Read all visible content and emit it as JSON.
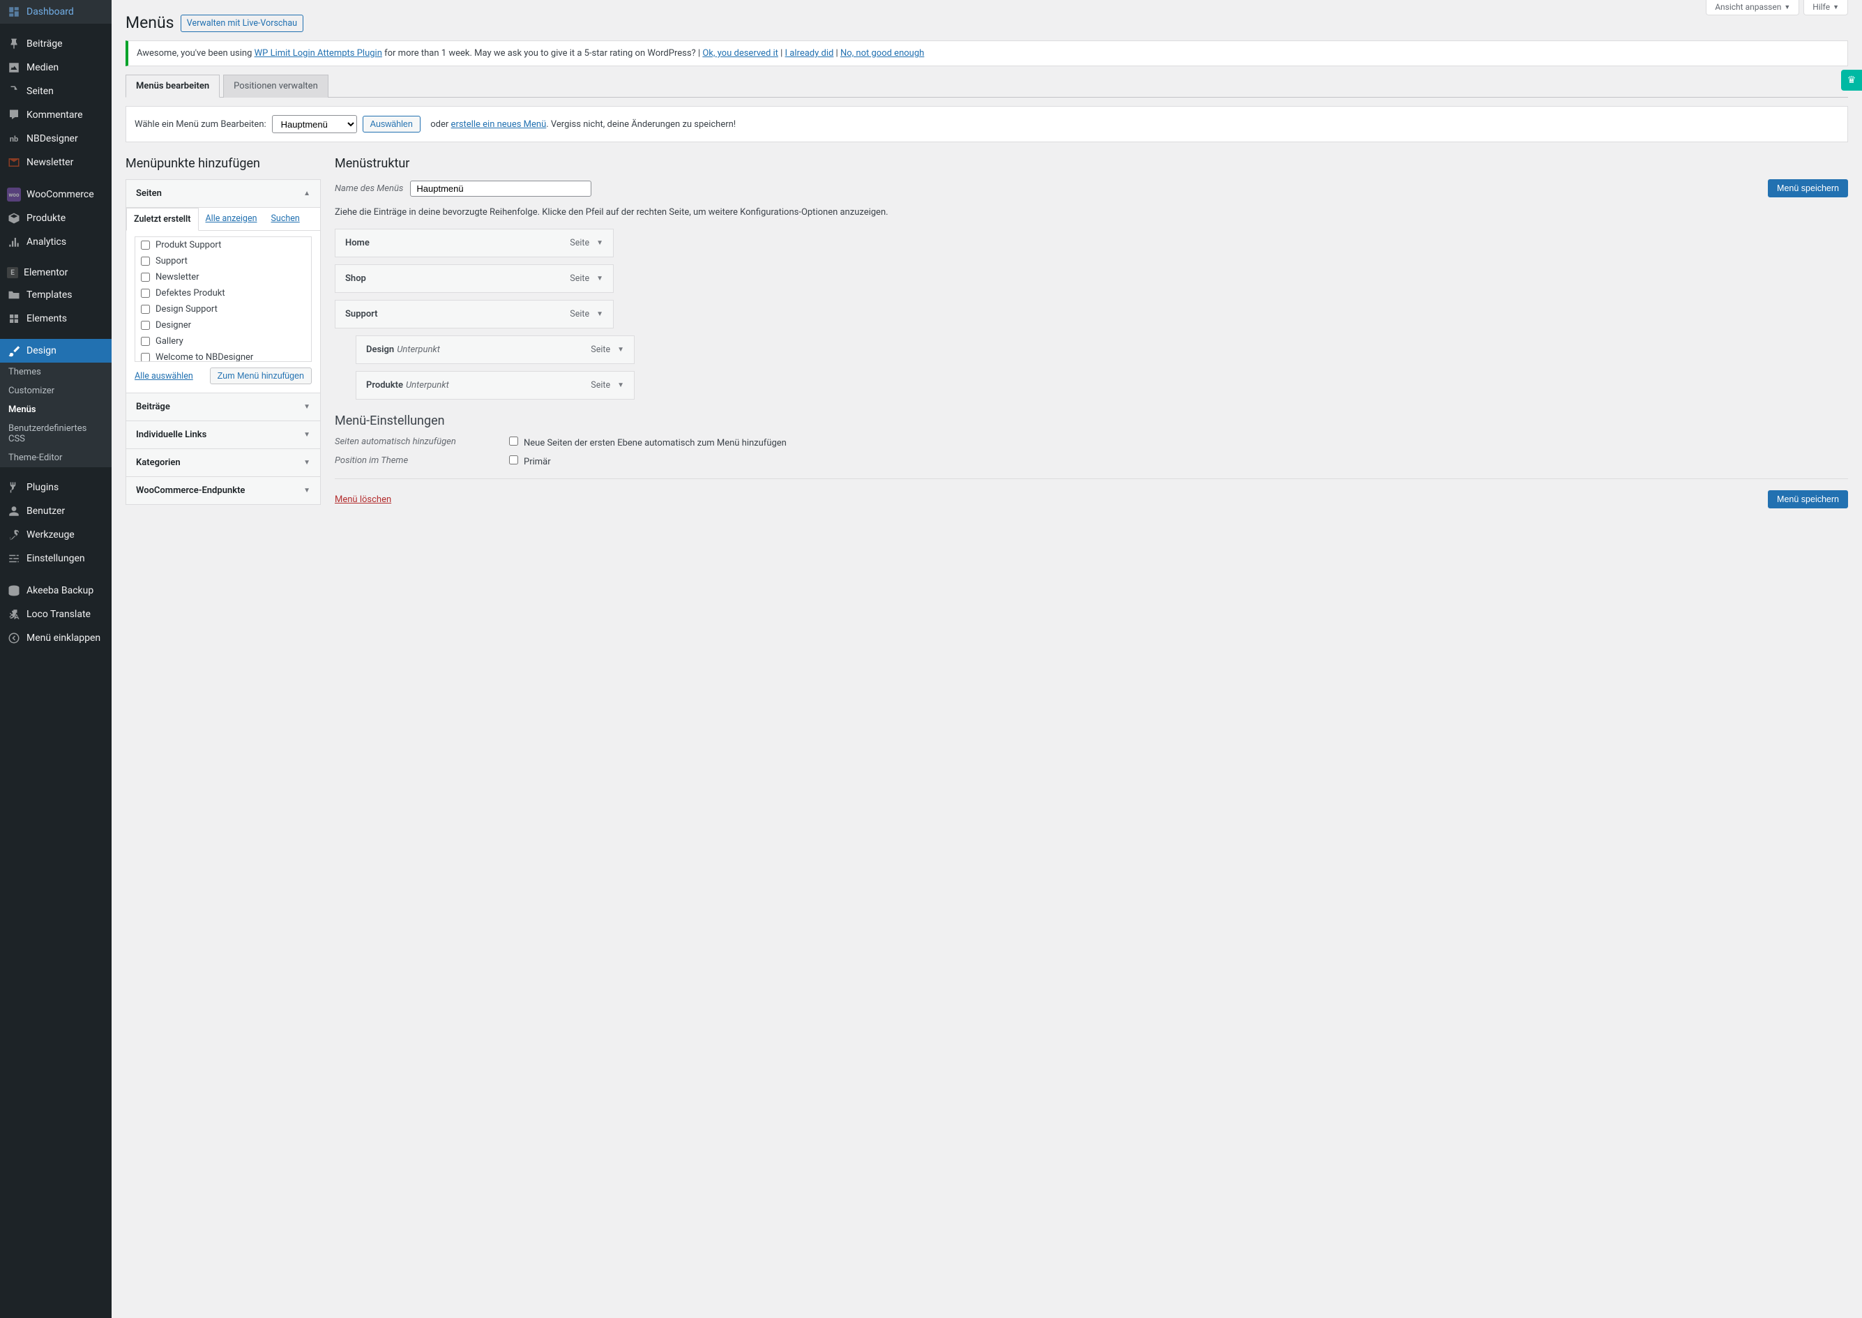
{
  "screenMeta": {
    "customize": "Ansicht anpassen",
    "help": "Hilfe"
  },
  "sidebar": {
    "items": [
      {
        "label": "Dashboard"
      },
      {
        "label": "Beiträge"
      },
      {
        "label": "Medien"
      },
      {
        "label": "Seiten"
      },
      {
        "label": "Kommentare"
      },
      {
        "label": "NBDesigner"
      },
      {
        "label": "Newsletter"
      },
      {
        "label": "WooCommerce"
      },
      {
        "label": "Produkte"
      },
      {
        "label": "Analytics"
      },
      {
        "label": "Elementor"
      },
      {
        "label": "Templates"
      },
      {
        "label": "Elements"
      },
      {
        "label": "Design"
      },
      {
        "label": "Plugins"
      },
      {
        "label": "Benutzer"
      },
      {
        "label": "Werkzeuge"
      },
      {
        "label": "Einstellungen"
      },
      {
        "label": "Akeeba Backup"
      },
      {
        "label": "Loco Translate"
      },
      {
        "label": "Menü einklappen"
      }
    ],
    "designSub": [
      {
        "label": "Themes"
      },
      {
        "label": "Customizer"
      },
      {
        "label": "Menüs"
      },
      {
        "label": "Benutzerdefiniertes CSS"
      },
      {
        "label": "Theme-Editor"
      }
    ]
  },
  "heading": "Menüs",
  "headingLink": "Verwalten mit Live-Vorschau",
  "notice": {
    "text1": "Awesome, you've been using ",
    "pluginLink": "WP Limit Login Attempts Plugin",
    "text2": " for more than 1 week. May we ask you to give it a 5-star rating on WordPress? | ",
    "link1": "Ok, you deserved it",
    "sep1": " | ",
    "link2": "I already did",
    "sep2": " | ",
    "link3": "No, not good enough"
  },
  "tabs": {
    "edit": "Menüs bearbeiten",
    "positions": "Positionen verwalten"
  },
  "selectBar": {
    "label": "Wähle ein Menü zum Bearbeiten:",
    "selected": "Hauptmenü",
    "choose": "Auswählen",
    "or": "oder",
    "create": "erstelle ein neues Menü",
    "reminder": ". Vergiss nicht, deine Änderungen zu speichern!"
  },
  "left": {
    "heading": "Menüpunkte hinzufügen",
    "acc": {
      "pages": "Seiten",
      "posts": "Beiträge",
      "links": "Individuelle Links",
      "cats": "Kategorien",
      "woo": "WooCommerce-Endpunkte"
    },
    "pageTabs": {
      "recent": "Zuletzt erstellt",
      "all": "Alle anzeigen",
      "search": "Suchen"
    },
    "pages": [
      "Produkt Support",
      "Support",
      "Newsletter",
      "Defektes Produkt",
      "Design Support",
      "Designer",
      "Gallery",
      "Welcome to NBDesigner"
    ],
    "selectAll": "Alle auswählen",
    "addToMenu": "Zum Menü hinzufügen"
  },
  "right": {
    "heading": "Menüstruktur",
    "nameLabel": "Name des Menüs",
    "nameValue": "Hauptmenü",
    "save": "Menü speichern",
    "instructions": "Ziehe die Einträge in deine bevorzugte Reihenfolge. Klicke den Pfeil auf der rechten Seite, um weitere Konfigurations-Optionen anzuzeigen.",
    "typeLabel": "Seite",
    "subLabel": "Unterpunkt",
    "items": [
      {
        "title": "Home",
        "sub": false
      },
      {
        "title": "Shop",
        "sub": false
      },
      {
        "title": "Support",
        "sub": false
      },
      {
        "title": "Design",
        "sub": true
      },
      {
        "title": "Produkte",
        "sub": true
      }
    ],
    "settingsH": "Menü-Einstellungen",
    "setting1Label": "Seiten automatisch hinzufügen",
    "setting1Text": "Neue Seiten der ersten Ebene automatisch zum Menü hinzufügen",
    "setting2Label": "Position im Theme",
    "setting2Text": "Primär",
    "delete": "Menü löschen"
  }
}
